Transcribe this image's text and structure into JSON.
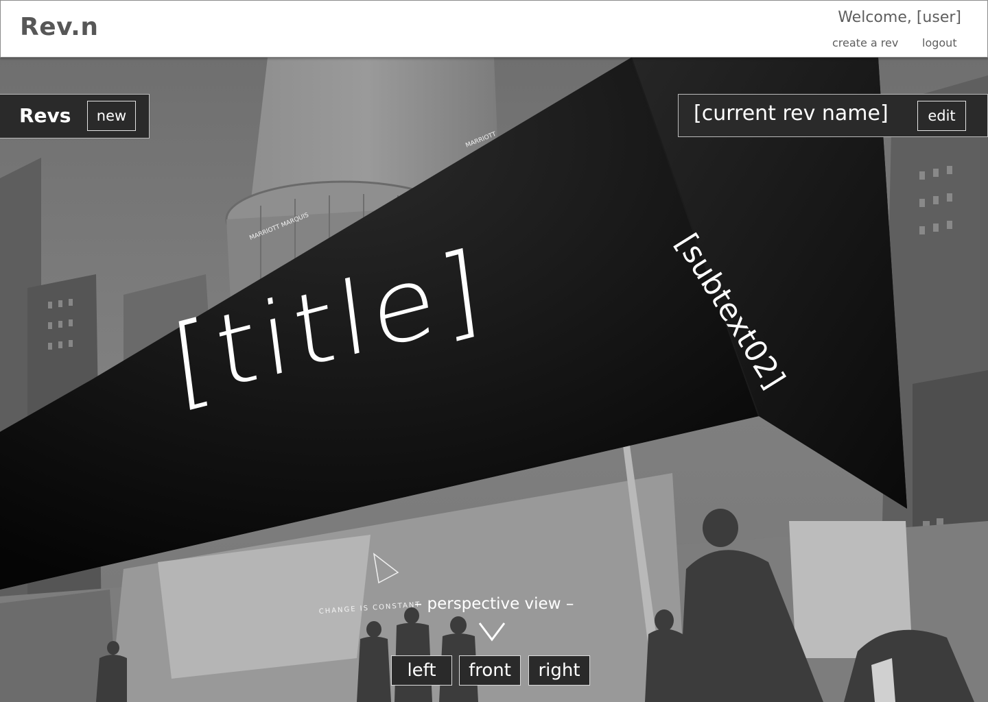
{
  "header": {
    "logo": "Rev.n",
    "welcome": "Welcome, [user]",
    "create_link": "create a rev",
    "logout_link": "logout"
  },
  "revs_panel": {
    "label": "Revs",
    "new_button": "new"
  },
  "current_rev": {
    "name": "[current rev name]",
    "edit_button": "edit"
  },
  "billboard": {
    "title": "[title]",
    "subtext": "[subtext02]"
  },
  "perspective": {
    "label": "– perspective view –",
    "views": [
      "left",
      "front",
      "right"
    ]
  },
  "background_signage": {
    "sign_1": "MARRIOTT",
    "sign_2": "MARRIOTT MARQUIS",
    "sign_3": "CHANGE IS CONSTANT"
  }
}
